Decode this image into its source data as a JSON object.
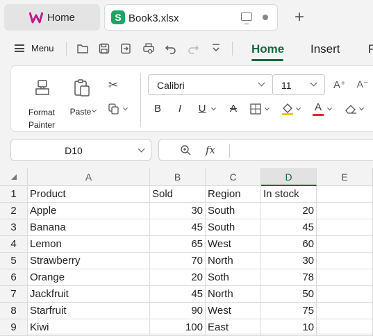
{
  "tabs": {
    "home_label": "Home",
    "file_label": "Book3.xlsx",
    "file_icon_letter": "S"
  },
  "menubar": {
    "menu_label": "Menu",
    "ribbon_tabs": [
      "Home",
      "Insert",
      "P"
    ]
  },
  "ribbon": {
    "format_painter_line1": "Format",
    "format_painter_line2": "Painter",
    "paste_label": "Paste",
    "font_name": "Calibri",
    "font_size": "11",
    "grow_font": "A⁺",
    "shrink_font": "A⁻",
    "bold": "B",
    "italic": "I",
    "underline": "U",
    "strike": "A",
    "font_color_letter": "A",
    "fx_label": "fx"
  },
  "formula_bar": {
    "name_box": "D10",
    "formula": ""
  },
  "colors": {
    "accent": "#11693d",
    "sheet_icon": "#1fa463",
    "highlight": "#f5c518",
    "font_red": "#d32f2f"
  },
  "grid": {
    "columns": [
      "A",
      "B",
      "C",
      "D",
      "E"
    ],
    "selected_column": "D",
    "row_numbers": [
      "1",
      "2",
      "3",
      "4",
      "5",
      "6",
      "7",
      "8",
      "9"
    ],
    "rows": [
      [
        "Product",
        "Sold",
        "Region",
        "In stock"
      ],
      [
        "Apple",
        "30",
        "South",
        "20"
      ],
      [
        "Banana",
        "45",
        "South",
        "45"
      ],
      [
        "Lemon",
        "65",
        "West",
        "60"
      ],
      [
        "Strawberry",
        "70",
        "North",
        "30"
      ],
      [
        "Orange",
        "20",
        "Soth",
        "78"
      ],
      [
        "Jackfruit",
        "45",
        "North",
        "50"
      ],
      [
        "Starfruit",
        "90",
        "West",
        "75"
      ],
      [
        "Kiwi",
        "100",
        "East",
        "10"
      ]
    ]
  }
}
